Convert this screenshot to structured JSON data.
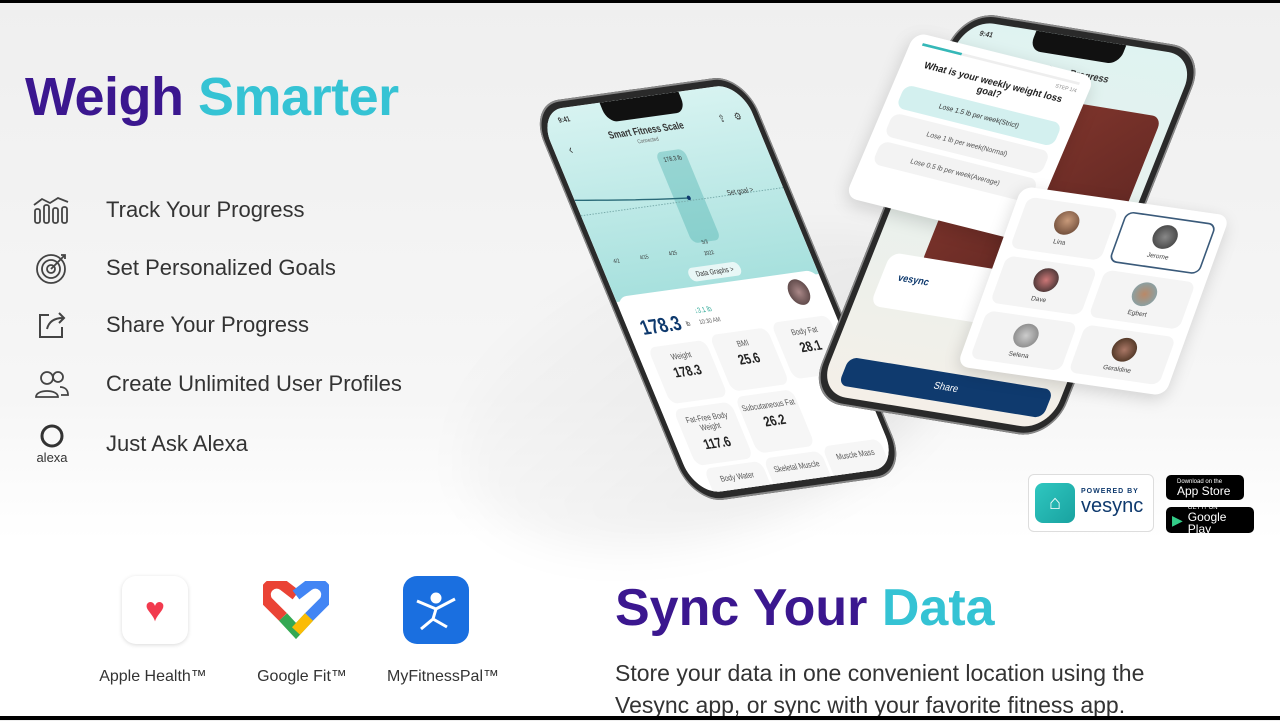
{
  "headline": {
    "part1": "Weigh",
    "part2": "Smarter"
  },
  "features": [
    {
      "icon": "bar-chart-icon",
      "label": "Track Your Progress"
    },
    {
      "icon": "target-icon",
      "label": "Set Personalized Goals"
    },
    {
      "icon": "share-icon",
      "label": "Share Your Progress"
    },
    {
      "icon": "users-icon",
      "label": "Create Unlimited User Profiles"
    },
    {
      "icon": "alexa-icon",
      "label": "Just Ask Alexa",
      "icon_text": "alexa"
    }
  ],
  "phone1": {
    "time": "9:41",
    "title": "Smart Fitness Scale",
    "status": "Connected",
    "tooltip": "178.3 lb",
    "set_goal": "Set goal >",
    "dates": [
      "4/2",
      "4/15",
      "4/25",
      "5/3"
    ],
    "year": "2022",
    "data_graphs": "Data Graphs >",
    "weight": "178.3",
    "unit": "lb",
    "change": "↓3.1 lb",
    "time_measured": "10:30 AM",
    "metrics": [
      {
        "label": "Weight",
        "value": "178.3",
        "unit": "lb"
      },
      {
        "label": "BMI",
        "value": "25.6",
        "unit": ""
      },
      {
        "label": "Body Fat",
        "value": "28.1",
        "unit": ""
      },
      {
        "label": "Fat-Free Body Weight",
        "value": "117.6",
        "unit": "lb"
      },
      {
        "label": "Subcutaneous Fat",
        "value": "26.2",
        "unit": "%"
      },
      {
        "label": "Body Water",
        "value": "",
        "unit": ""
      },
      {
        "label": "Skeletal Muscle",
        "value": "",
        "unit": ""
      },
      {
        "label": "Muscle Mass",
        "value": "",
        "unit": ""
      }
    ]
  },
  "phone2": {
    "time": "9:41",
    "title": "Share Progress",
    "brand": "vesync",
    "share": "Share"
  },
  "goal_card": {
    "step": "STEP 1/4",
    "question": "What is your weekly weight loss goal?",
    "options": [
      "Lose 1.5 lb per week(Strict)",
      "Lose 1 lb per week(Normal)",
      "Lose 0.5 lb per week(Average)"
    ],
    "selected": 0
  },
  "profiles": [
    "Lina",
    "Jerome",
    "Dave",
    "Egbert",
    "Selena",
    "Geraldine"
  ],
  "selected_profile": "Jerome",
  "badges": {
    "powered_by": "POWERED BY",
    "vesync": "vesync",
    "appstore_small": "Download on the",
    "appstore": "App Store",
    "gplay_small": "GET IT ON",
    "gplay": "Google Play"
  },
  "apps": [
    {
      "label": "Apple Health™",
      "icon": "heart-icon"
    },
    {
      "label": "Google Fit™",
      "icon": "google-fit-icon"
    },
    {
      "label": "MyFitnessPal™",
      "icon": "myfitnesspal-icon"
    }
  ],
  "sync": {
    "title1": "Sync Your",
    "title2": "Data",
    "body_line1": "Store your data in one convenient location using the",
    "body_line2": "Vesync app, or sync with your favorite fitness app."
  },
  "colors": {
    "purple": "#3b178f",
    "cyan": "#35c3d4",
    "navy": "#0f3a6e"
  }
}
